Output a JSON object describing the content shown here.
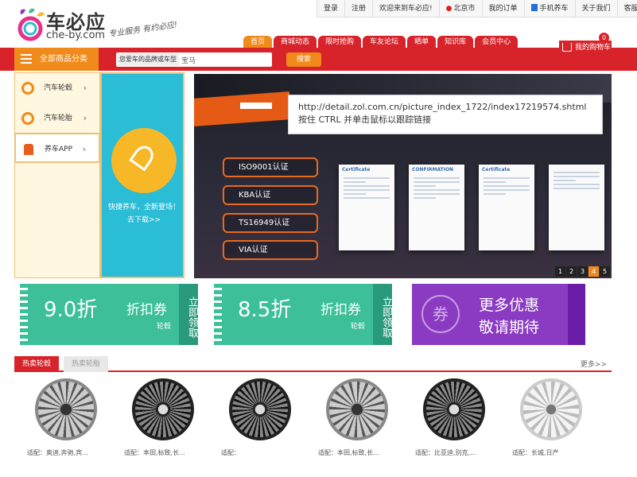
{
  "logo": {
    "cn": "车必应",
    "en": "che-by.com",
    "slogan": "专业服务  有约必应!"
  },
  "top_links": [
    "登录",
    "注册",
    "欢迎来到车必应!",
    "北京市",
    "我的订单",
    "手机养车",
    "关于我们",
    "客服热线"
  ],
  "nav": {
    "tabs": [
      "首页",
      "商城动态",
      "限时抢购",
      "车友论坛",
      "晒单",
      "知识库",
      "会员中心"
    ],
    "active": 0
  },
  "cart": {
    "label": "我的购物车",
    "count": "0"
  },
  "categories_button": "全部商品分类",
  "search": {
    "select_label": "您爱车的品牌或车型",
    "value": "宝马",
    "button": "搜索"
  },
  "sidebar": {
    "items": [
      {
        "label": "汽车轮毂",
        "icon": "wheel-hub-icon"
      },
      {
        "label": "汽车轮胎",
        "icon": "tire-icon"
      },
      {
        "label": "养车APP",
        "icon": "app-icon"
      }
    ]
  },
  "promo": {
    "line1": "快捷养车，全新登场！",
    "line2": "去下载>>"
  },
  "banner": {
    "certs": [
      "ISO9001认证",
      "KBA认证",
      "TS16949认证",
      "VIA认证"
    ],
    "pages": [
      "1",
      "2",
      "3",
      "4",
      "5"
    ],
    "active_page": "4",
    "doc_titles": [
      "Certificate",
      "CONFIRMATION",
      "Certificate",
      ""
    ]
  },
  "tooltip": {
    "line1": "http://detail.zol.com.cn/picture_index_1722/index17219574.shtml",
    "line2": "按住 CTRL 并单击鼠标以跟踪链接"
  },
  "coupons": [
    {
      "value": "9.0折",
      "label": "折扣券",
      "sub": "轮毂",
      "grab": "立即领取"
    },
    {
      "value": "8.5折",
      "label": "折扣券",
      "sub": "轮毂",
      "grab": "立即领取"
    }
  ],
  "more_promo": {
    "icon_text": "券",
    "line1": "更多优惠",
    "line2": "敬请期待"
  },
  "hot": {
    "tabs": [
      "热卖轮毂",
      "热卖轮胎"
    ],
    "more": "更多>>"
  },
  "products": [
    {
      "caption": "适配：奥迪,奔驰,宾..."
    },
    {
      "caption": "适配：本田,标致,长..."
    },
    {
      "caption": "适配："
    },
    {
      "caption": "适配：本田,标致,长..."
    },
    {
      "caption": "适配：比亚迪,别克,..."
    },
    {
      "caption": "适配：长城,日产"
    }
  ],
  "colors": {
    "brand_red": "#d8232a",
    "orange": "#f08a1a",
    "cyan": "#2bbcd6",
    "green": "#3dbf9a",
    "purple": "#8a3bc2"
  }
}
